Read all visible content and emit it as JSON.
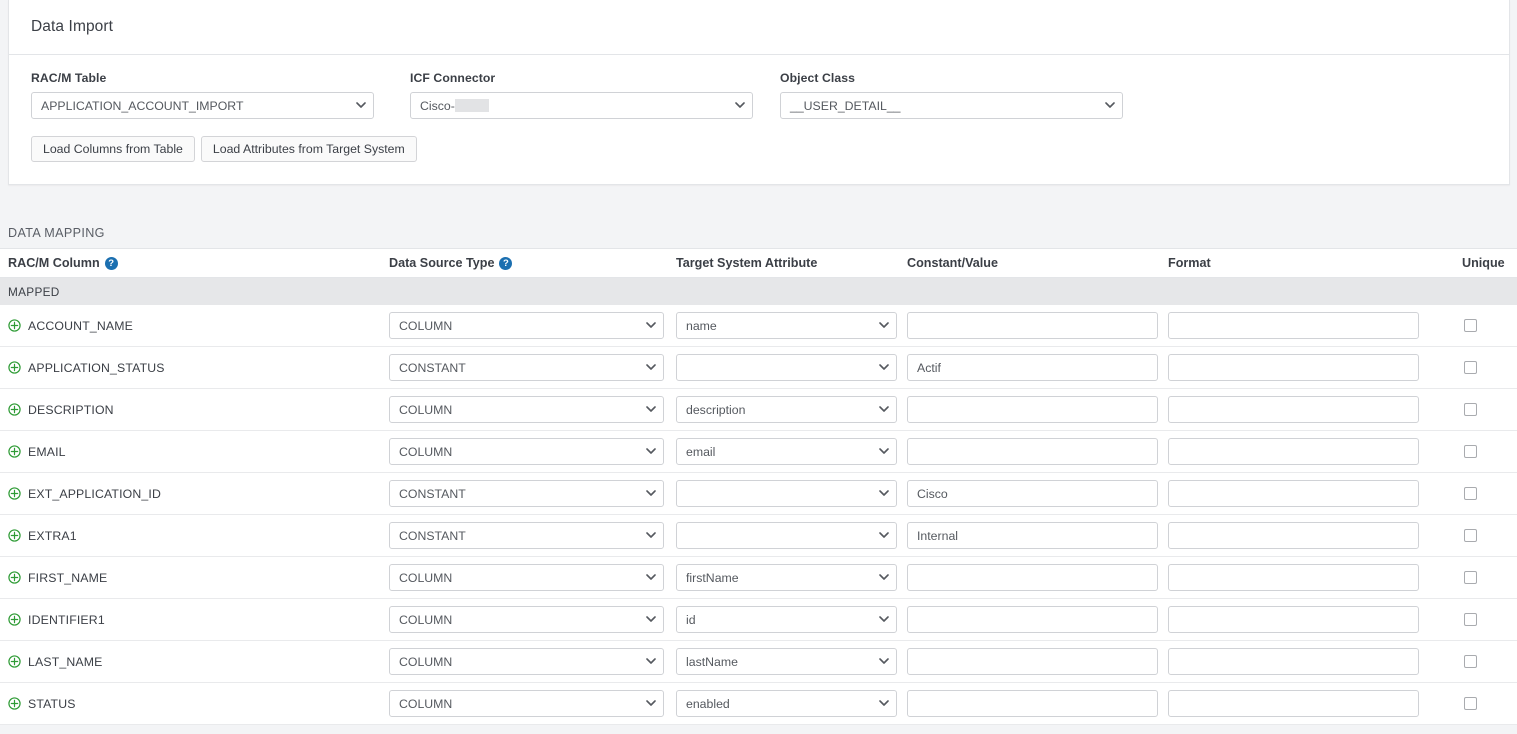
{
  "card": {
    "title": "Data Import",
    "fields": [
      {
        "label": "RAC/M Table",
        "value": "APPLICATION_ACCOUNT_IMPORT",
        "redacted": false
      },
      {
        "label": "ICF Connector",
        "value": "Cisco-",
        "redacted": true
      },
      {
        "label": "Object Class",
        "value": "__USER_DETAIL__",
        "redacted": false
      }
    ],
    "buttons": [
      {
        "label": "Load Columns from Table"
      },
      {
        "label": "Load Attributes from Target System"
      }
    ]
  },
  "mapping": {
    "section_title": "DATA MAPPING",
    "group_label": "MAPPED",
    "headers": {
      "racm_column": "RAC/M Column",
      "data_source_type": "Data Source Type",
      "target_system_attribute": "Target System Attribute",
      "constant_value": "Constant/Value",
      "format": "Format",
      "unique": "Unique"
    },
    "help_glyph": "?",
    "rows": [
      {
        "column": "ACCOUNT_NAME",
        "source_type": "COLUMN",
        "attribute": "name",
        "constant": "",
        "format": "",
        "unique": false
      },
      {
        "column": "APPLICATION_STATUS",
        "source_type": "CONSTANT",
        "attribute": "",
        "constant": "Actif",
        "format": "",
        "unique": false
      },
      {
        "column": "DESCRIPTION",
        "source_type": "COLUMN",
        "attribute": "description",
        "constant": "",
        "format": "",
        "unique": false
      },
      {
        "column": "EMAIL",
        "source_type": "COLUMN",
        "attribute": "email",
        "constant": "",
        "format": "",
        "unique": false
      },
      {
        "column": "EXT_APPLICATION_ID",
        "source_type": "CONSTANT",
        "attribute": "",
        "constant": "Cisco",
        "format": "",
        "unique": false
      },
      {
        "column": "EXTRA1",
        "source_type": "CONSTANT",
        "attribute": "",
        "constant": "Internal",
        "format": "",
        "unique": false
      },
      {
        "column": "FIRST_NAME",
        "source_type": "COLUMN",
        "attribute": "firstName",
        "constant": "",
        "format": "",
        "unique": false
      },
      {
        "column": "IDENTIFIER1",
        "source_type": "COLUMN",
        "attribute": "id",
        "constant": "",
        "format": "",
        "unique": false
      },
      {
        "column": "LAST_NAME",
        "source_type": "COLUMN",
        "attribute": "lastName",
        "constant": "",
        "format": "",
        "unique": false
      },
      {
        "column": "STATUS",
        "source_type": "COLUMN",
        "attribute": "enabled",
        "constant": "",
        "format": "",
        "unique": false
      }
    ]
  },
  "colors": {
    "page_background": "#f3f4f6",
    "card_background": "#ffffff",
    "group_row": "#e6e7e9",
    "help_icon": "#1b6fb0",
    "add_icon": "#2e9b35",
    "border": "#e3e5e8"
  }
}
